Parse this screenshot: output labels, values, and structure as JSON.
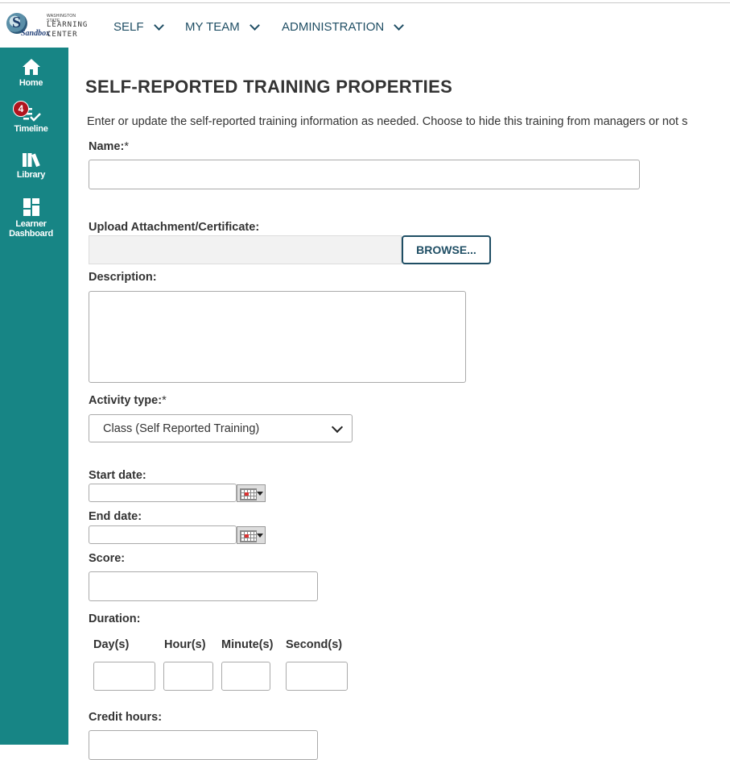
{
  "logo": {
    "state": "WASHINGTON STATE",
    "line1": "LEARNING",
    "line2": "CENTER",
    "sandbox": "Sandbox"
  },
  "nav": [
    {
      "label": "SELF"
    },
    {
      "label": "MY TEAM"
    },
    {
      "label": "ADMINISTRATION"
    }
  ],
  "sidebar": {
    "items": [
      {
        "label": "Home",
        "icon": "home-icon"
      },
      {
        "label": "Timeline",
        "icon": "timeline-icon",
        "badge": "4"
      },
      {
        "label": "Library",
        "icon": "library-icon"
      },
      {
        "label": "Learner Dashboard",
        "icon": "dashboard-icon"
      }
    ]
  },
  "colors": {
    "sidebar": "#178585",
    "accent": "#1f4e64",
    "badge": "#b0141e"
  },
  "page": {
    "title": "SELF-REPORTED TRAINING PROPERTIES",
    "intro": "Enter or update the self-reported training information as needed. Choose to hide this training from managers or not s"
  },
  "form": {
    "name_label": "Name:",
    "name_value": "",
    "upload_label": "Upload Attachment/Certificate:",
    "browse_label": "BROWSE...",
    "description_label": "Description:",
    "activity_label": "Activity type:",
    "activity_value": "Class (Self Reported Training)",
    "required_mark": "*",
    "start_label": "Start date:",
    "end_label": "End date:",
    "score_label": "Score:",
    "duration_label": "Duration:",
    "duration": {
      "days": "Day(s)",
      "hours": "Hour(s)",
      "minutes": "Minute(s)",
      "seconds": "Second(s)"
    },
    "credit_label": "Credit hours:"
  }
}
